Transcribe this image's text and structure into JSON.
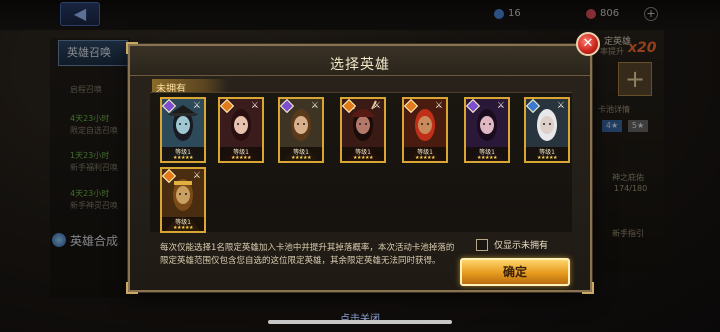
{
  "background": {
    "back_icon": "◀",
    "resources": [
      {
        "value": "16",
        "color": "#4a8be0"
      },
      {
        "value": "806",
        "color": "#e0505a"
      }
    ],
    "left_panel": {
      "tab_label": "英雄召唤",
      "items": [
        {
          "label": "启程召唤",
          "color": "gray"
        },
        {
          "label": "4天23小时",
          "color": "green"
        },
        {
          "label": "限定自选召唤",
          "color": "gray"
        },
        {
          "label": "1天23小时",
          "color": "green"
        },
        {
          "label": "新手福利召唤",
          "color": "gray"
        },
        {
          "label": "4天23小时",
          "color": "green"
        },
        {
          "label": "新手神灵召唤",
          "color": "gray"
        }
      ],
      "bottom_label": "英雄合成"
    },
    "right_panel": {
      "label_top": "定英雄",
      "label_sub": "率提升",
      "multiplier": "x20",
      "plus_icon": "+",
      "detail_label": "卡池详情",
      "star4": "4★",
      "star5": "5★",
      "progress_label": "神之庇佑",
      "progress_value": "174/180",
      "guide_label": "新手指引"
    },
    "close_hint": "点击关闭"
  },
  "dialog": {
    "title": "选择英雄",
    "close_icon": "✕",
    "section_label": "未拥有",
    "heroes": [
      {
        "name": "hero-pirate-ghost",
        "faction_color": "#7b4fd0",
        "level": "等级1",
        "stars": "★★★★★",
        "weapon": "⚔"
      },
      {
        "name": "hero-dark-maiden",
        "faction_color": "#e07a1a",
        "level": "等级1",
        "stars": "★★★★★",
        "weapon": "⚔"
      },
      {
        "name": "hero-sage-warrior",
        "faction_color": "#7b4fd0",
        "level": "等级1",
        "stars": "★★★★★",
        "weapon": "⚔"
      },
      {
        "name": "hero-crimson-warlord",
        "faction_color": "#e07a1a",
        "level": "等级1",
        "stars": "★★★★★",
        "weapon": "⚔"
      },
      {
        "name": "hero-flame-demon",
        "faction_color": "#e07a1a",
        "level": "等级1",
        "stars": "★★★★★",
        "weapon": "⚔"
      },
      {
        "name": "hero-shadow-sorceress",
        "faction_color": "#7b4fd0",
        "level": "等级1",
        "stars": "★★★★★",
        "weapon": "⚔"
      },
      {
        "name": "hero-white-hunter",
        "faction_color": "#3a7ad0",
        "level": "等级1",
        "stars": "★★★★★",
        "weapon": "⚔"
      },
      {
        "name": "hero-monkey-king",
        "faction_color": "#e07a1a",
        "level": "等级1",
        "stars": "★★★★★",
        "weapon": "⚔"
      }
    ],
    "description": "每次仅能选择1名限定英雄加入卡池中并提升其掉落概率，本次活动卡池掉落的限定英雄范围仅包含您自选的这位限定英雄，其余限定英雄无法同时获得。",
    "checkbox_label": "仅显示未拥有",
    "checkbox_checked": false,
    "confirm_label": "确定"
  }
}
